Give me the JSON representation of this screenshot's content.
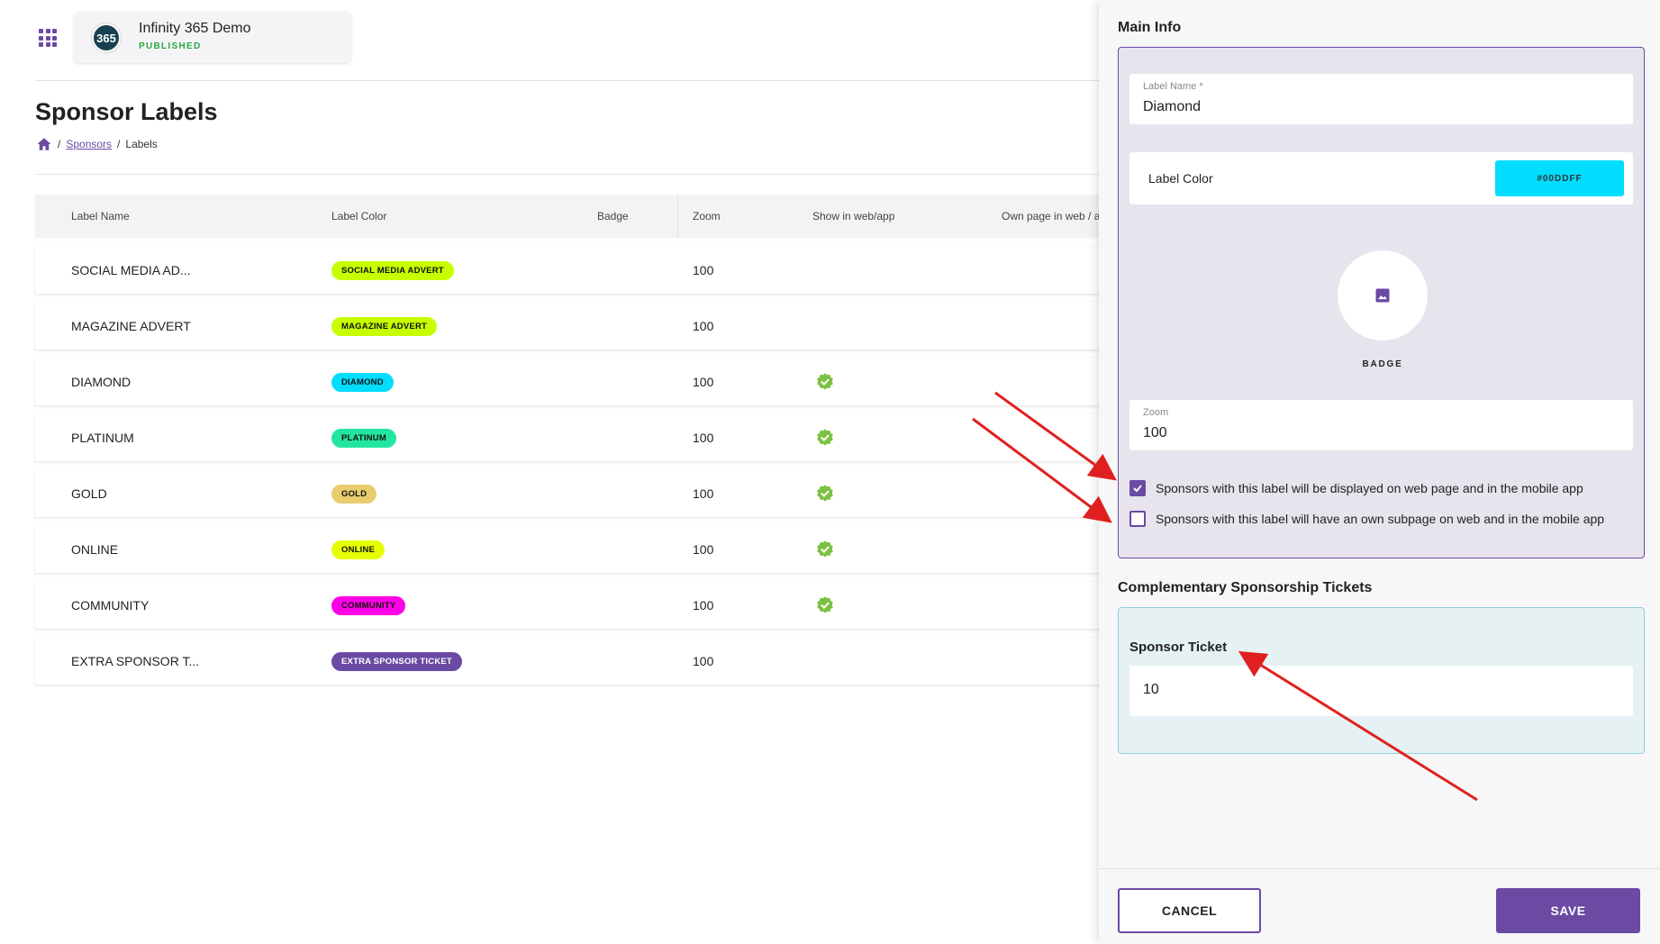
{
  "app": {
    "name": "Infinity 365 Demo",
    "logo_text": "365",
    "status": "PUBLISHED"
  },
  "page": {
    "title": "Sponsor Labels",
    "breadcrumb": {
      "sponsors": "Sponsors",
      "separator": "/",
      "current": "Labels"
    }
  },
  "table": {
    "headers": {
      "label_name": "Label Name",
      "label_color": "Label Color",
      "badge": "Badge",
      "zoom": "Zoom",
      "show": "Show in web/app",
      "own_page": "Own page in web / a"
    },
    "rows": [
      {
        "name": "SOCIAL MEDIA AD...",
        "pill": "SOCIAL MEDIA ADVERT",
        "color": "#c6ff00",
        "text_color": "#111111",
        "zoom": "100",
        "show": false
      },
      {
        "name": "MAGAZINE ADVERT",
        "pill": "MAGAZINE ADVERT",
        "color": "#c6ff00",
        "text_color": "#111111",
        "zoom": "100",
        "show": false
      },
      {
        "name": "DIAMOND",
        "pill": "DIAMOND",
        "color": "#00ddff",
        "text_color": "#111111",
        "zoom": "100",
        "show": true
      },
      {
        "name": "PLATINUM",
        "pill": "PLATINUM",
        "color": "#22e6a0",
        "text_color": "#111111",
        "zoom": "100",
        "show": true
      },
      {
        "name": "GOLD",
        "pill": "GOLD",
        "color": "#e8cc6e",
        "text_color": "#111111",
        "zoom": "100",
        "show": true
      },
      {
        "name": "ONLINE",
        "pill": "ONLINE",
        "color": "#e6ff00",
        "text_color": "#111111",
        "zoom": "100",
        "show": true
      },
      {
        "name": "COMMUNITY",
        "pill": "COMMUNITY",
        "color": "#ff00e6",
        "text_color": "#111111",
        "zoom": "100",
        "show": true
      },
      {
        "name": "EXTRA SPONSOR T...",
        "pill": "EXTRA SPONSOR TICKET",
        "color": "#6a4aa3",
        "text_color": "#ffffff",
        "zoom": "100",
        "show": false
      }
    ]
  },
  "panel": {
    "main_info_title": "Main Info",
    "label_name": {
      "label": "Label Name *",
      "value": "Diamond"
    },
    "label_color": {
      "label": "Label Color",
      "value": "#00DDFF"
    },
    "badge_label": "BADGE",
    "zoom": {
      "label": "Zoom",
      "value": "100"
    },
    "checkbox_display": {
      "label": "Sponsors with this label will be displayed on web page and in the mobile app",
      "checked": true
    },
    "checkbox_subpage": {
      "label": "Sponsors with this label will have an own subpage on web and in the mobile app",
      "checked": false
    },
    "tickets_title": "Complementary Sponsorship Tickets",
    "sponsor_ticket": {
      "label": "Sponsor Ticket",
      "value": "10"
    },
    "cancel_label": "CANCEL",
    "save_label": "SAVE"
  },
  "colors": {
    "accent": "#6a4aa3",
    "published": "#28a745",
    "check_green": "#7cc242",
    "annotation_arrow": "#e02020"
  },
  "icons": [
    "apps-grid-icon",
    "home-icon",
    "check-badge-icon",
    "image-icon",
    "checkbox-checked-icon"
  ]
}
